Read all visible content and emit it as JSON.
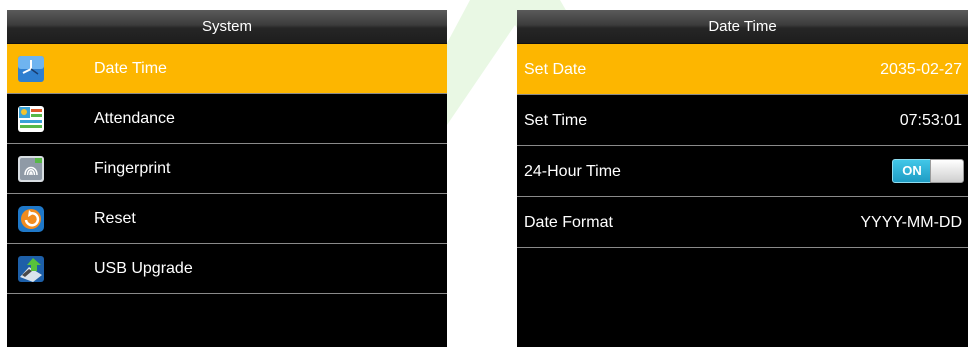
{
  "left_screen": {
    "title": "System",
    "items": [
      {
        "label": "Date Time",
        "icon": "clock-icon",
        "selected": true
      },
      {
        "label": "Attendance",
        "icon": "attendance-icon",
        "selected": false
      },
      {
        "label": "Fingerprint",
        "icon": "fingerprint-icon",
        "selected": false
      },
      {
        "label": "Reset",
        "icon": "reset-icon",
        "selected": false
      },
      {
        "label": "USB Upgrade",
        "icon": "usb-upgrade-icon",
        "selected": false
      }
    ]
  },
  "right_screen": {
    "title": "Date Time",
    "rows": [
      {
        "label": "Set Date",
        "value": "2035-02-27",
        "selected": true
      },
      {
        "label": "Set Time",
        "value": "07:53:01",
        "selected": false
      },
      {
        "label": "24-Hour Time",
        "toggle_text": "ON",
        "selected": false
      },
      {
        "label": "Date Format",
        "value": "YYYY-MM-DD",
        "selected": false
      }
    ]
  },
  "colors": {
    "highlight": "#fdb600",
    "screen_bg": "#000000",
    "text": "#ffffff",
    "toggle_on": "#2bb0d8"
  }
}
